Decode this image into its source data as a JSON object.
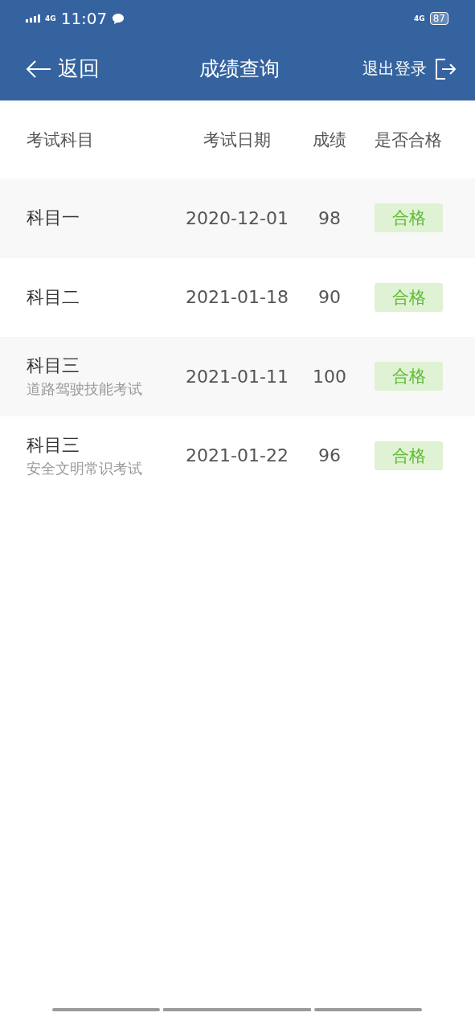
{
  "status_bar": {
    "network_left": "4G",
    "time": "11:07",
    "network_right": "4G",
    "battery": "87"
  },
  "header": {
    "back": "返回",
    "title": "成绩查询",
    "logout": "退出登录"
  },
  "table": {
    "columns": [
      "考试科目",
      "考试日期",
      "成绩",
      "是否合格"
    ],
    "rows": [
      {
        "subject": "科目一",
        "date": "2020-12-01",
        "score": "98",
        "result": "合格"
      },
      {
        "subject": "科目二",
        "date": "2021-01-18",
        "score": "90",
        "result": "合格"
      },
      {
        "subject": "科目三",
        "subtitle": "道路驾驶技能考试",
        "date": "2021-01-11",
        "score": "100",
        "result": "合格"
      },
      {
        "subject": "科目三",
        "subtitle": "安全文明常识考试",
        "date": "2021-01-22",
        "score": "96",
        "result": "合格"
      }
    ]
  }
}
